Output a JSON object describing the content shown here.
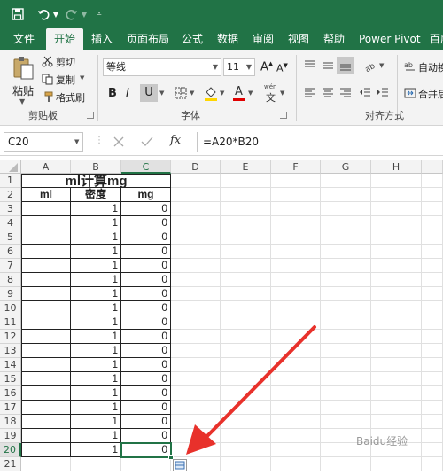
{
  "ribbon_tabs": [
    "文件",
    "开始",
    "插入",
    "页面布局",
    "公式",
    "数据",
    "审阅",
    "视图",
    "帮助",
    "Power Pivot",
    "百度"
  ],
  "active_tab": "开始",
  "clipboard": {
    "paste": "粘贴",
    "cut": "剪切",
    "copy": "复制",
    "format_painter": "格式刷",
    "group_label": "剪贴板"
  },
  "font": {
    "name": "等线",
    "size": "11",
    "bold": "B",
    "italic": "I",
    "underline": "U",
    "grow": "A",
    "shrink": "A",
    "group_label": "字体",
    "phonetic": "wén"
  },
  "alignment": {
    "wrap_text": "自动换",
    "merge": "合并后",
    "group_label": "对齐方式"
  },
  "name_box": "C20",
  "formula": "=A20*B20",
  "fx_label": "fx",
  "columns": [
    "A",
    "B",
    "C",
    "D",
    "E",
    "F",
    "G",
    "H"
  ],
  "selected_column": "C",
  "selected_row": "20",
  "sheet": {
    "title": "ml计算mg",
    "headers": [
      "ml",
      "密度",
      "mg"
    ],
    "rows": [
      {
        "row": "3",
        "ml": "",
        "density": "1",
        "mg": "0"
      },
      {
        "row": "4",
        "ml": "",
        "density": "1",
        "mg": "0"
      },
      {
        "row": "5",
        "ml": "",
        "density": "1",
        "mg": "0"
      },
      {
        "row": "6",
        "ml": "",
        "density": "1",
        "mg": "0"
      },
      {
        "row": "7",
        "ml": "",
        "density": "1",
        "mg": "0"
      },
      {
        "row": "8",
        "ml": "",
        "density": "1",
        "mg": "0"
      },
      {
        "row": "9",
        "ml": "",
        "density": "1",
        "mg": "0"
      },
      {
        "row": "10",
        "ml": "",
        "density": "1",
        "mg": "0"
      },
      {
        "row": "11",
        "ml": "",
        "density": "1",
        "mg": "0"
      },
      {
        "row": "12",
        "ml": "",
        "density": "1",
        "mg": "0"
      },
      {
        "row": "13",
        "ml": "",
        "density": "1",
        "mg": "0"
      },
      {
        "row": "14",
        "ml": "",
        "density": "1",
        "mg": "0"
      },
      {
        "row": "15",
        "ml": "",
        "density": "1",
        "mg": "0"
      },
      {
        "row": "16",
        "ml": "",
        "density": "1",
        "mg": "0"
      },
      {
        "row": "17",
        "ml": "",
        "density": "1",
        "mg": "0"
      },
      {
        "row": "18",
        "ml": "",
        "density": "1",
        "mg": "0"
      },
      {
        "row": "19",
        "ml": "",
        "density": "1",
        "mg": "0"
      },
      {
        "row": "20",
        "ml": "",
        "density": "1",
        "mg": "0"
      }
    ]
  },
  "row_numbers": [
    "1",
    "2",
    "3",
    "4",
    "5",
    "6",
    "7",
    "8",
    "9",
    "10",
    "11",
    "12",
    "13",
    "14",
    "15",
    "16",
    "17",
    "18",
    "19",
    "20",
    "21"
  ],
  "watermark": "Baidu经验",
  "colors": {
    "excel_green": "#217346",
    "arrow_red": "#e8312b"
  }
}
